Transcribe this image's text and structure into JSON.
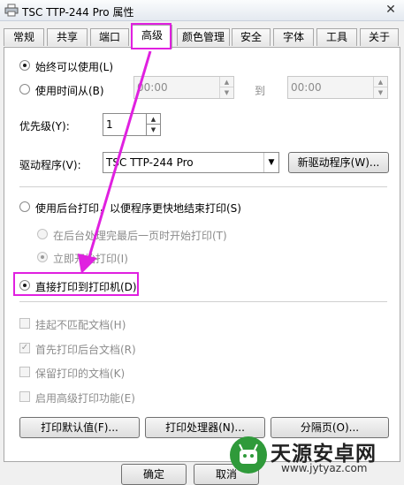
{
  "window": {
    "title": "TSC TTP-244 Pro 属性",
    "close_glyph": "✕",
    "icon": "printer-icon"
  },
  "tabs": [
    {
      "label": "常规"
    },
    {
      "label": "共享"
    },
    {
      "label": "端口"
    },
    {
      "label": "高级",
      "selected": true
    },
    {
      "label": "颜色管理"
    },
    {
      "label": "安全"
    },
    {
      "label": "字体"
    },
    {
      "label": "工具"
    },
    {
      "label": "关于"
    }
  ],
  "availability": {
    "always_label": "始终可以使用(L)",
    "from_label": "使用时间从(B)",
    "from_value": "00:00",
    "to_label": "到",
    "to_value": "00:00",
    "selected": "always"
  },
  "priority": {
    "label": "优先级(Y):",
    "value": "1"
  },
  "driver": {
    "label": "驱动程序(V):",
    "value": "TSC TTP-244 Pro",
    "new_driver_button": "新驱动程序(W)..."
  },
  "spooling": {
    "spool_label": "使用后台打印，以便程序更快地结束打印(S)",
    "after_last_page_label": "在后台处理完最后一页时开始打印(T)",
    "immediately_label": "立即开始打印(I)",
    "direct_label": "直接打印到打印机(D)",
    "selected": "direct"
  },
  "options": [
    {
      "label": "挂起不匹配文档(H)",
      "checked": false
    },
    {
      "label": "首先打印后台文档(R)",
      "checked": true
    },
    {
      "label": "保留打印的文档(K)",
      "checked": false
    },
    {
      "label": "启用高级打印功能(E)",
      "checked": false
    }
  ],
  "buttons": {
    "defaults": "打印默认值(F)...",
    "processor": "打印处理器(N)...",
    "separator": "分隔页(O)...",
    "ok": "确定",
    "cancel": "取消"
  },
  "annotation": {
    "highlight_color": "#e020e0"
  },
  "watermark": {
    "brand": "天源安卓网",
    "url": "www.jytyaz.com"
  },
  "colors": {
    "panel": "#ffffff",
    "dialog": "#f0f0f0",
    "disabled_text": "#8c8c8c"
  }
}
